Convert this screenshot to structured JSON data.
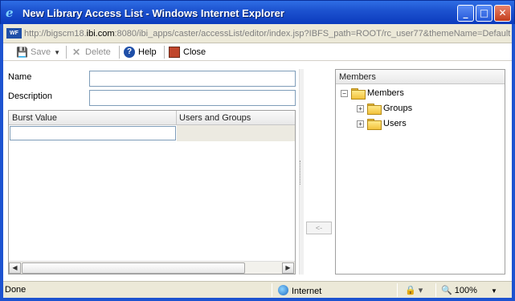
{
  "window": {
    "title": "New Library Access List - Windows Internet Explorer",
    "controls": {
      "minimize": "_",
      "maximize": "□",
      "close": "✕"
    }
  },
  "address": {
    "prefix": "http://bigscm18.",
    "domain": "ibi.com",
    "suffix": ":8080/ibi_apps/caster/accessList/editor/index.jsp?IBFS_path=ROOT/rc_user77&themeName=Default",
    "favicon_text": "WF"
  },
  "toolbar": {
    "save_label": "Save",
    "delete_label": "Delete",
    "help_label": "Help",
    "close_label": "Close"
  },
  "form": {
    "name_label": "Name",
    "name_value": "",
    "description_label": "Description",
    "description_value": ""
  },
  "grid": {
    "columns": [
      "Burst Value",
      "Users and Groups"
    ],
    "rows": [
      {
        "burst_value": "",
        "users_and_groups": ""
      }
    ]
  },
  "move_button": "<-",
  "members_panel": {
    "header": "Members",
    "tree": {
      "label": "Members",
      "expanded": true,
      "children": [
        {
          "label": "Groups",
          "expanded": false
        },
        {
          "label": "Users",
          "expanded": false
        }
      ]
    }
  },
  "status": {
    "text": "Done",
    "zone": "Internet",
    "zoom": "100%"
  },
  "colors": {
    "titlebar": "#1d53d0",
    "chrome": "#ece9d8",
    "folder": "#f2c23c"
  }
}
